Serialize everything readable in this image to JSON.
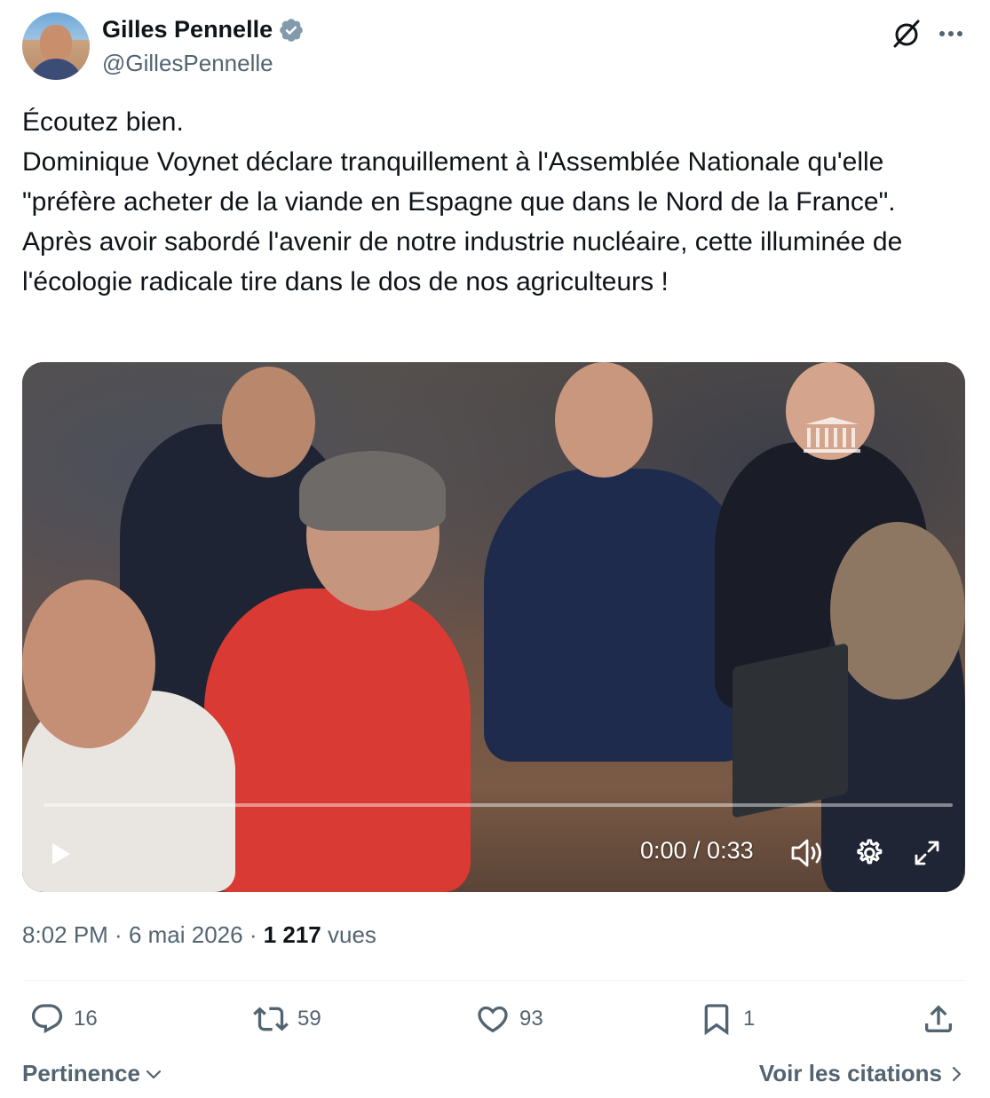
{
  "author": {
    "name": "Gilles Pennelle",
    "handle": "@GillesPennelle",
    "verified_color": "#829aab"
  },
  "tweet": {
    "lines": [
      "Écoutez bien.",
      "Dominique Voynet déclare tranquillement à l'Assemblée Nationale qu'elle \"préfère acheter de la viande en Espagne que dans le Nord de la France\".",
      "Après avoir sabordé l'avenir de notre industrie nucléaire, cette illuminée de l'écologie radicale tire dans le dos de nos agriculteurs !"
    ]
  },
  "video": {
    "time": "0:00 / 0:33",
    "progress": 0
  },
  "meta": {
    "time": "8:02 PM",
    "separator1": " · ",
    "date": "6 mai 2026",
    "separator2": " · ",
    "views_count": "1 217",
    "views_label": " vues"
  },
  "actions": {
    "replies": "16",
    "reposts": "59",
    "likes": "93",
    "bookmarks": "1"
  },
  "footer": {
    "sort_label": "Pertinence",
    "quotes_label": "Voir les citations"
  },
  "colors": {
    "text": "#0f1419",
    "secondary": "#536471",
    "divider": "#eff3f4"
  }
}
